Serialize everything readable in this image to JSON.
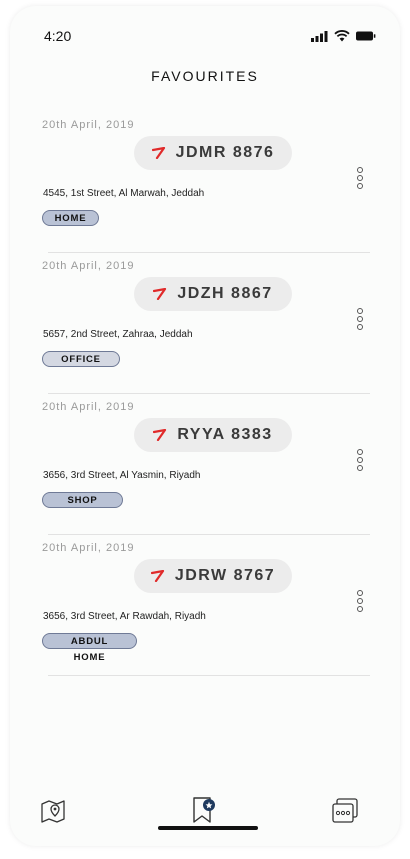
{
  "status_bar": {
    "time": "4:20"
  },
  "page": {
    "title": "FAVOURITES"
  },
  "favourites": [
    {
      "date": "20th April, 2019",
      "plate": "JDMR 8876",
      "address": "4545, 1st Street, Al Marwah, Jeddah",
      "tag": "HOME"
    },
    {
      "date": "20th April, 2019",
      "plate": "JDZH 8867",
      "address": "5657, 2nd Street, Zahraa, Jeddah",
      "tag": "OFFICE"
    },
    {
      "date": "20th April, 2019",
      "plate": "RYYA 8383",
      "address": "3656, 3rd Street, Al Yasmin, Riyadh",
      "tag": "SHOP"
    },
    {
      "date": "20th April, 2019",
      "plate": "JDRW 8767",
      "address": "3656, 3rd Street,  Ar Rawdah, Riyadh",
      "tag": "ABDUL HOME"
    }
  ],
  "colors": {
    "accent": "#e02a2a",
    "tag_fill": "#b9c2d5",
    "tag_border": "#6f7a96",
    "plate_bg": "#ececec",
    "active_badge": "#1f3a5f"
  },
  "icons": {
    "map": "map-pin-icon",
    "favourites": "bookmark-star-icon",
    "more": "more-options-icon"
  }
}
